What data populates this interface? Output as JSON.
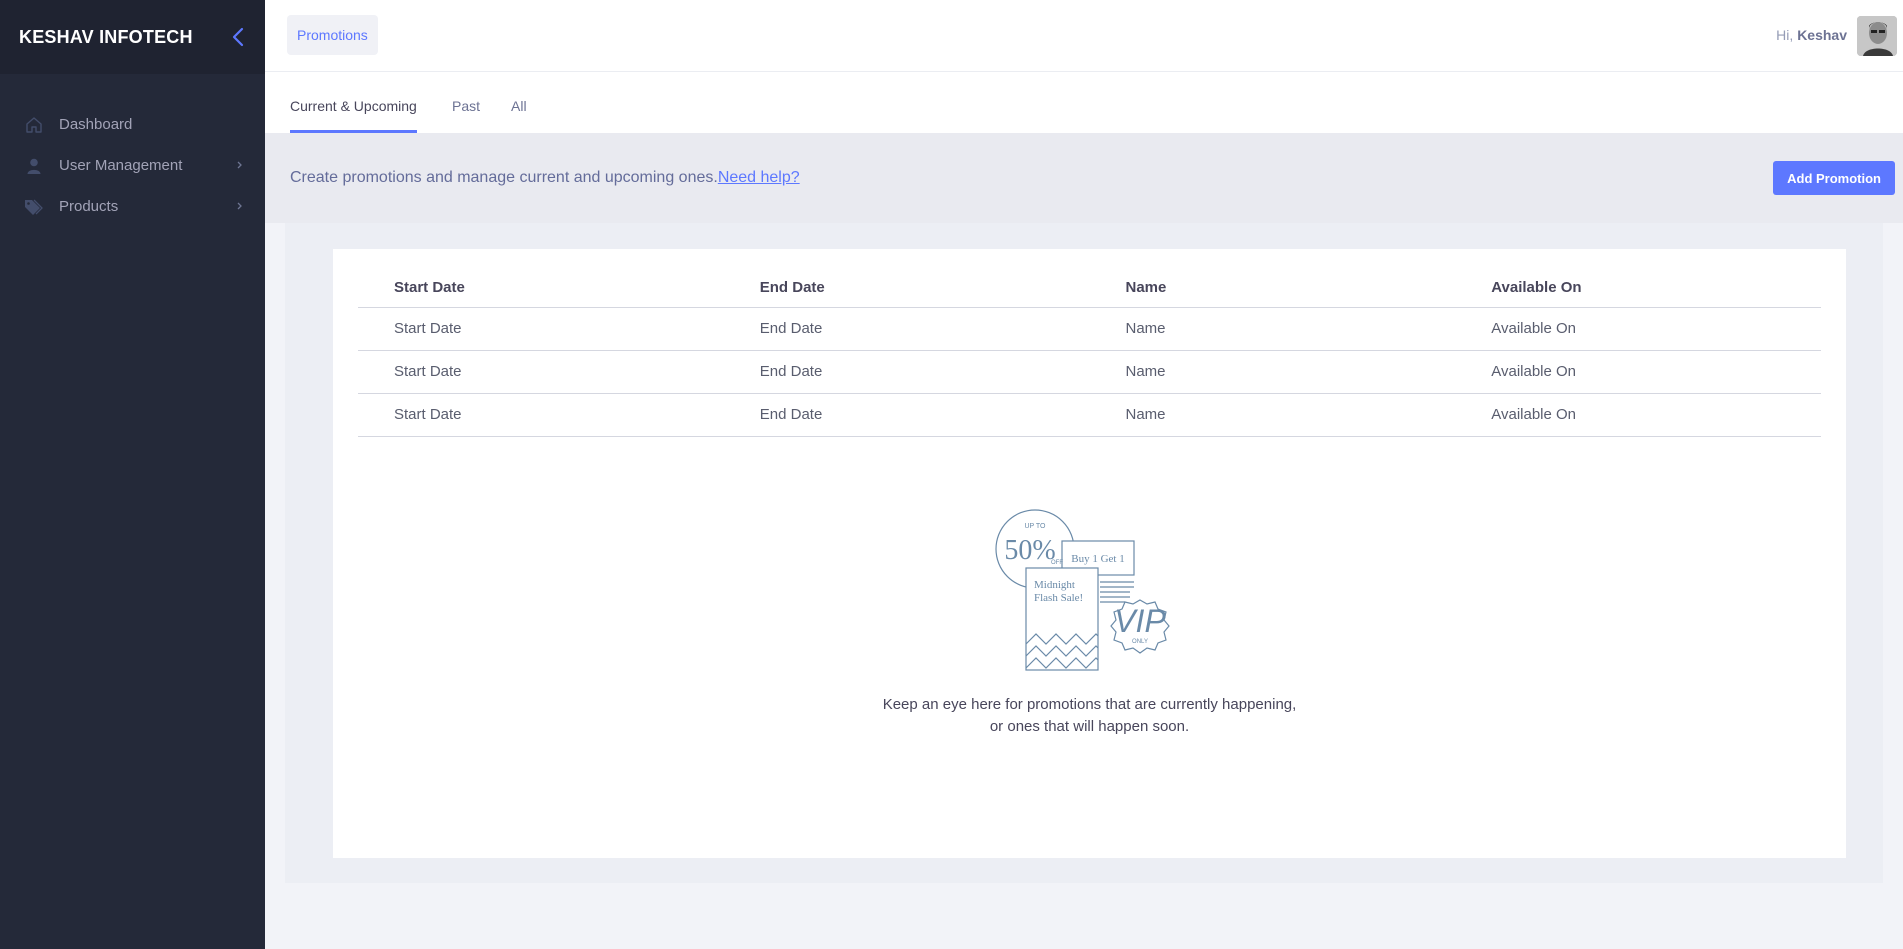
{
  "sidebar": {
    "brand": "KESHAV INFOTECH",
    "items": [
      {
        "label": "Dashboard",
        "icon": "home-icon"
      },
      {
        "label": "User Management",
        "icon": "user-icon"
      },
      {
        "label": "Products",
        "icon": "tags-icon"
      }
    ]
  },
  "header": {
    "breadcrumb": "Promotions",
    "greeting": "Hi,",
    "user_name": "Keshav"
  },
  "tabs": [
    {
      "label": "Current & Upcoming",
      "active": true
    },
    {
      "label": "Past",
      "active": false
    },
    {
      "label": "All",
      "active": false
    }
  ],
  "subheader": {
    "text": "Create promotions and manage current and upcoming ones.",
    "help_link": "Need help?",
    "add_button": "Add Promotion"
  },
  "table": {
    "columns": [
      "Start Date",
      "End Date",
      "Name",
      "Available On"
    ],
    "rows": [
      [
        "Start Date",
        "End Date",
        "Name",
        "Available On"
      ],
      [
        "Start Date",
        "End Date",
        "Name",
        "Available On"
      ],
      [
        "Start Date",
        "End Date",
        "Name",
        "Available On"
      ]
    ]
  },
  "empty_state": {
    "illustration_text": {
      "up_to": "UP TO",
      "percent": "50%",
      "off": "OFF",
      "buy": "Buy 1 Get 1",
      "midnight": "Midnight",
      "flash": "Flash Sale!",
      "vip": "VIP",
      "only": "ONLY"
    },
    "line1": "Keep an eye here for promotions that are currently happening,",
    "line2": "or ones that will happen soon."
  },
  "colors": {
    "accent": "#5d78ff",
    "sidebar_bg": "#242939",
    "illustration": "#6a8aa8"
  }
}
